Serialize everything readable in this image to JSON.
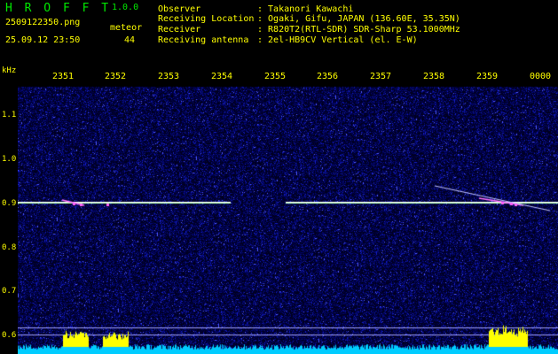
{
  "app_title": "H R O F F T",
  "app_version": "1.0.0",
  "file_name": "2509122350.png",
  "meteor_label": "meteor",
  "datetime": "25.09.12 23:50",
  "meteor_count": "44",
  "info": [
    {
      "label": "Observer",
      "value": ": Takanori Kawachi"
    },
    {
      "label": "Receiving Location",
      "value": ": Ogaki, Gifu, JAPAN (136.60E, 35.35N)"
    },
    {
      "label": "Receiver",
      "value": ": R820T2(RTL-SDR) SDR-Sharp 53.1000MHz"
    },
    {
      "label": "Receiving antenna",
      "value": ": 2el-HB9CV Vertical (el. E-W)"
    }
  ],
  "freq_unit": "kHz",
  "time_ticks": [
    "2351",
    "2352",
    "2353",
    "2354",
    "2355",
    "2356",
    "2357",
    "2358",
    "2359",
    "0000"
  ],
  "freq_ticks": [
    "1.1",
    "1.0",
    "0.9",
    "0.8",
    "0.7",
    "0.6"
  ],
  "colors": {
    "text": "#ffff00",
    "title": "#00e800",
    "background": "#000000",
    "carrier": "#b0ffb0",
    "histogram": "#00ccff",
    "histogram_peak": "#ffff00"
  }
}
